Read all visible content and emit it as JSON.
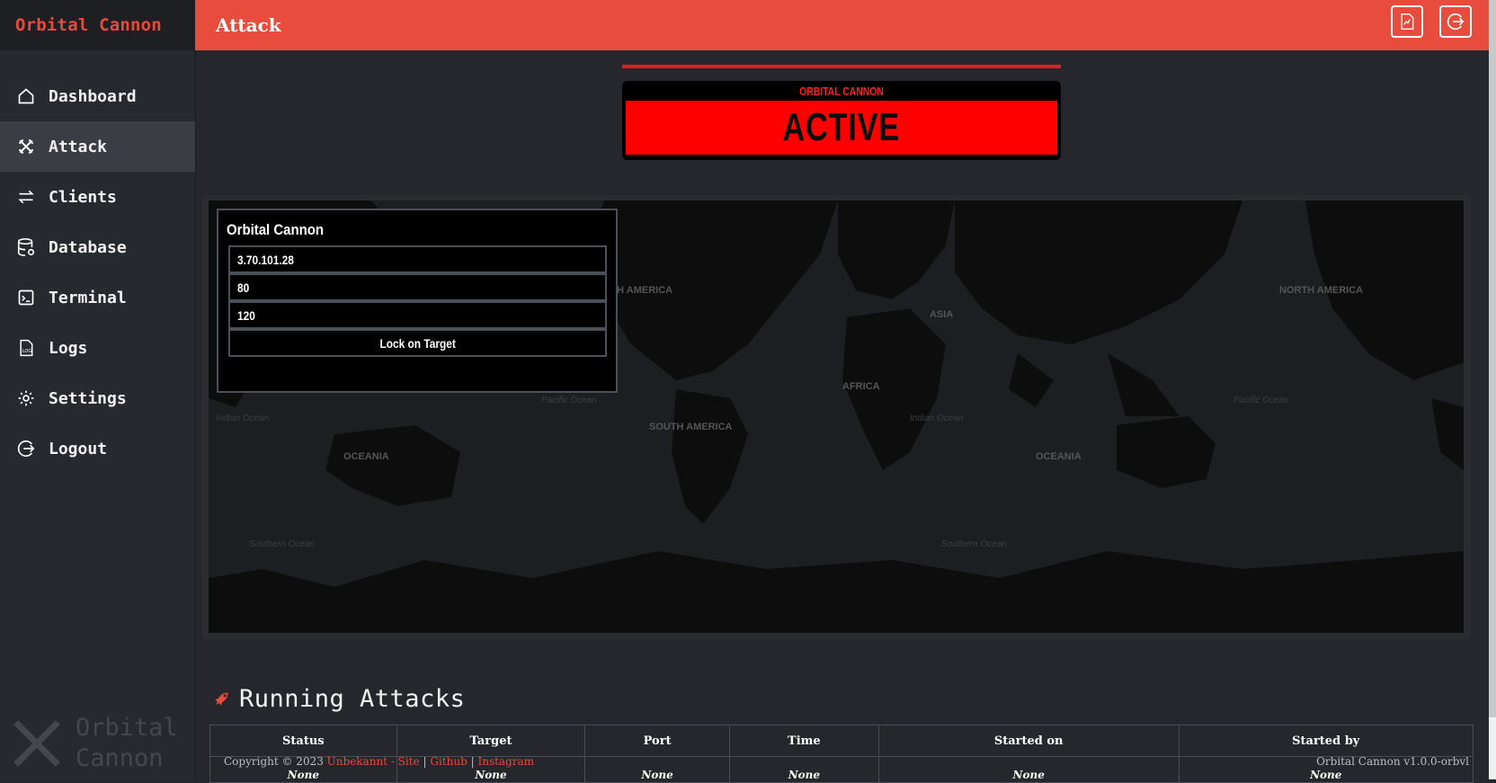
{
  "app": {
    "brand": "Orbital Cannon",
    "page_title": "Attack"
  },
  "sidebar": {
    "items": [
      {
        "label": "Dashboard",
        "icon": "home-icon",
        "active": false
      },
      {
        "label": "Attack",
        "icon": "swords-icon",
        "active": true
      },
      {
        "label": "Clients",
        "icon": "arrows-swap-icon",
        "active": false
      },
      {
        "label": "Database",
        "icon": "database-icon",
        "active": false
      },
      {
        "label": "Terminal",
        "icon": "terminal-icon",
        "active": false
      },
      {
        "label": "Logs",
        "icon": "log-file-icon",
        "active": false
      },
      {
        "label": "Settings",
        "icon": "gear-icon",
        "active": false
      },
      {
        "label": "Logout",
        "icon": "logout-icon",
        "active": false
      }
    ],
    "watermark": {
      "line1": "Orbital",
      "line2": "Cannon"
    }
  },
  "topbar": {
    "buttons": [
      {
        "icon": "report-chart-icon"
      },
      {
        "icon": "logout-icon"
      }
    ]
  },
  "status": {
    "subtitle": "ORBITAL CANNON",
    "state": "ACTIVE",
    "color": "#ff0000"
  },
  "map": {
    "labels": {
      "north_america": "NORTH AMERICA",
      "asia": "ASIA",
      "africa": "AFRICA",
      "south_america": "SOUTH AMERICA",
      "oceania": "OCEANIA"
    },
    "oceans": {
      "indian": "Indian Ocean",
      "pacific": "Pacific Ocean",
      "southern": "Southern Ocean"
    }
  },
  "target_form": {
    "title": "Orbital Cannon",
    "ip": "3.70.101.28",
    "port": "80",
    "time": "120",
    "submit_label": "Lock on Target"
  },
  "running_attacks": {
    "heading": "Running Attacks",
    "columns": [
      "Status",
      "Target",
      "Port",
      "Time",
      "Started on",
      "Started by"
    ],
    "rows": [
      [
        "None",
        "None",
        "None",
        "None",
        "None",
        "None"
      ]
    ]
  },
  "footer": {
    "copyright": "Copyright © 2023",
    "author_link": "Unbekannt - Site",
    "sep": "|",
    "github": "Github",
    "instagram": "Instagram",
    "version": "Orbital Cannon v1.0.0-orbvl"
  },
  "colors": {
    "accent": "#e84c3d",
    "sidebar": "#26292e",
    "background": "#25272c"
  }
}
